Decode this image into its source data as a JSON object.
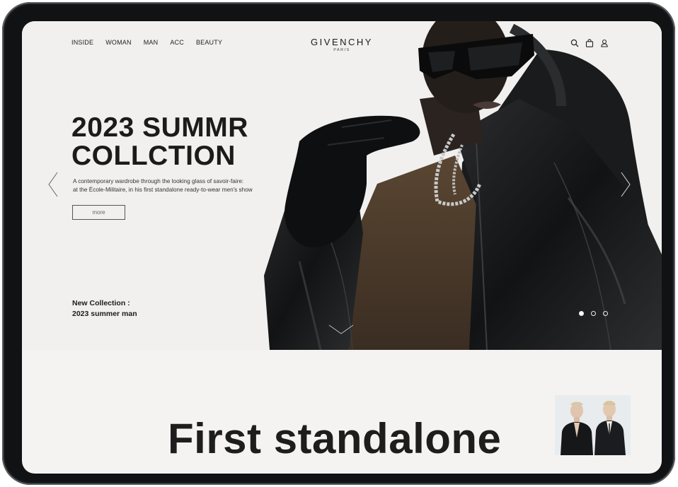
{
  "nav": {
    "items": [
      "INSIDE",
      "WOMAN",
      "MAN",
      "ACC",
      "BEAUTY"
    ]
  },
  "brand": {
    "name": "GIVENCHY",
    "sub": "PARIS"
  },
  "header_icons": [
    "search-icon",
    "bag-icon",
    "user-icon"
  ],
  "hero": {
    "headline_line1": "2023 SUMMR",
    "headline_line2": "COLLCTION",
    "description_line1": "A contemporary wardrobe through the looking glass of savoir-faire:",
    "description_line2": "at the École-Militaire, in his first standalone ready-to-wear men's show",
    "more_label": "more",
    "new_collection_line1": "New Collection :",
    "new_collection_line2": "2023 summer man",
    "slides_total": 3,
    "active_slide": 1
  },
  "section": {
    "title": "First standalone"
  },
  "colors": {
    "background": "#f4f3f1",
    "text": "#1b1b1b",
    "device_frame": "#111214"
  }
}
